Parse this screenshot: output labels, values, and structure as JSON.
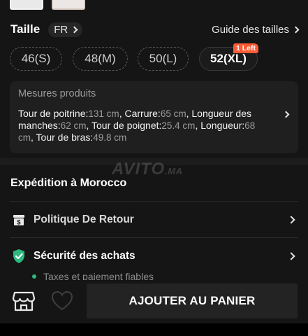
{
  "size_section": {
    "title": "Taille",
    "region": "FR",
    "guide_label": "Guide des tailles",
    "options": [
      {
        "label": "46(S)",
        "selected": false
      },
      {
        "label": "48(M)",
        "selected": false
      },
      {
        "label": "50(L)",
        "selected": false
      },
      {
        "label": "52(XL)",
        "selected": true,
        "badge": "1 Left"
      }
    ]
  },
  "measures": {
    "title": "Mesures produits",
    "items": [
      {
        "label": "Tour de poitrine:",
        "value": "131 cm"
      },
      {
        "label": "Carrure:",
        "value": "65 cm"
      },
      {
        "label": "Longueur des manches:",
        "value": "62 cm"
      },
      {
        "label": "Tour de poignet:",
        "value": "25.4 cm"
      },
      {
        "label": "Longueur:",
        "value": "68 cm"
      },
      {
        "label": "Tour de bras:",
        "value": "49.8 cm"
      }
    ]
  },
  "watermark": {
    "text": "AVITO",
    "suffix": ".MA"
  },
  "shipping": {
    "title": "Expédition à Morocco"
  },
  "rows": {
    "return_policy": "Politique De Retour",
    "security": "Sécurité des achats",
    "security_sub": "Taxes et paiement fiables"
  },
  "bottom_bar": {
    "add_to_cart": "AJOUTER AU PANIER"
  },
  "colors": {
    "background": "#151515",
    "badge": "#ff5a35",
    "security_green": "#2fb77f"
  }
}
